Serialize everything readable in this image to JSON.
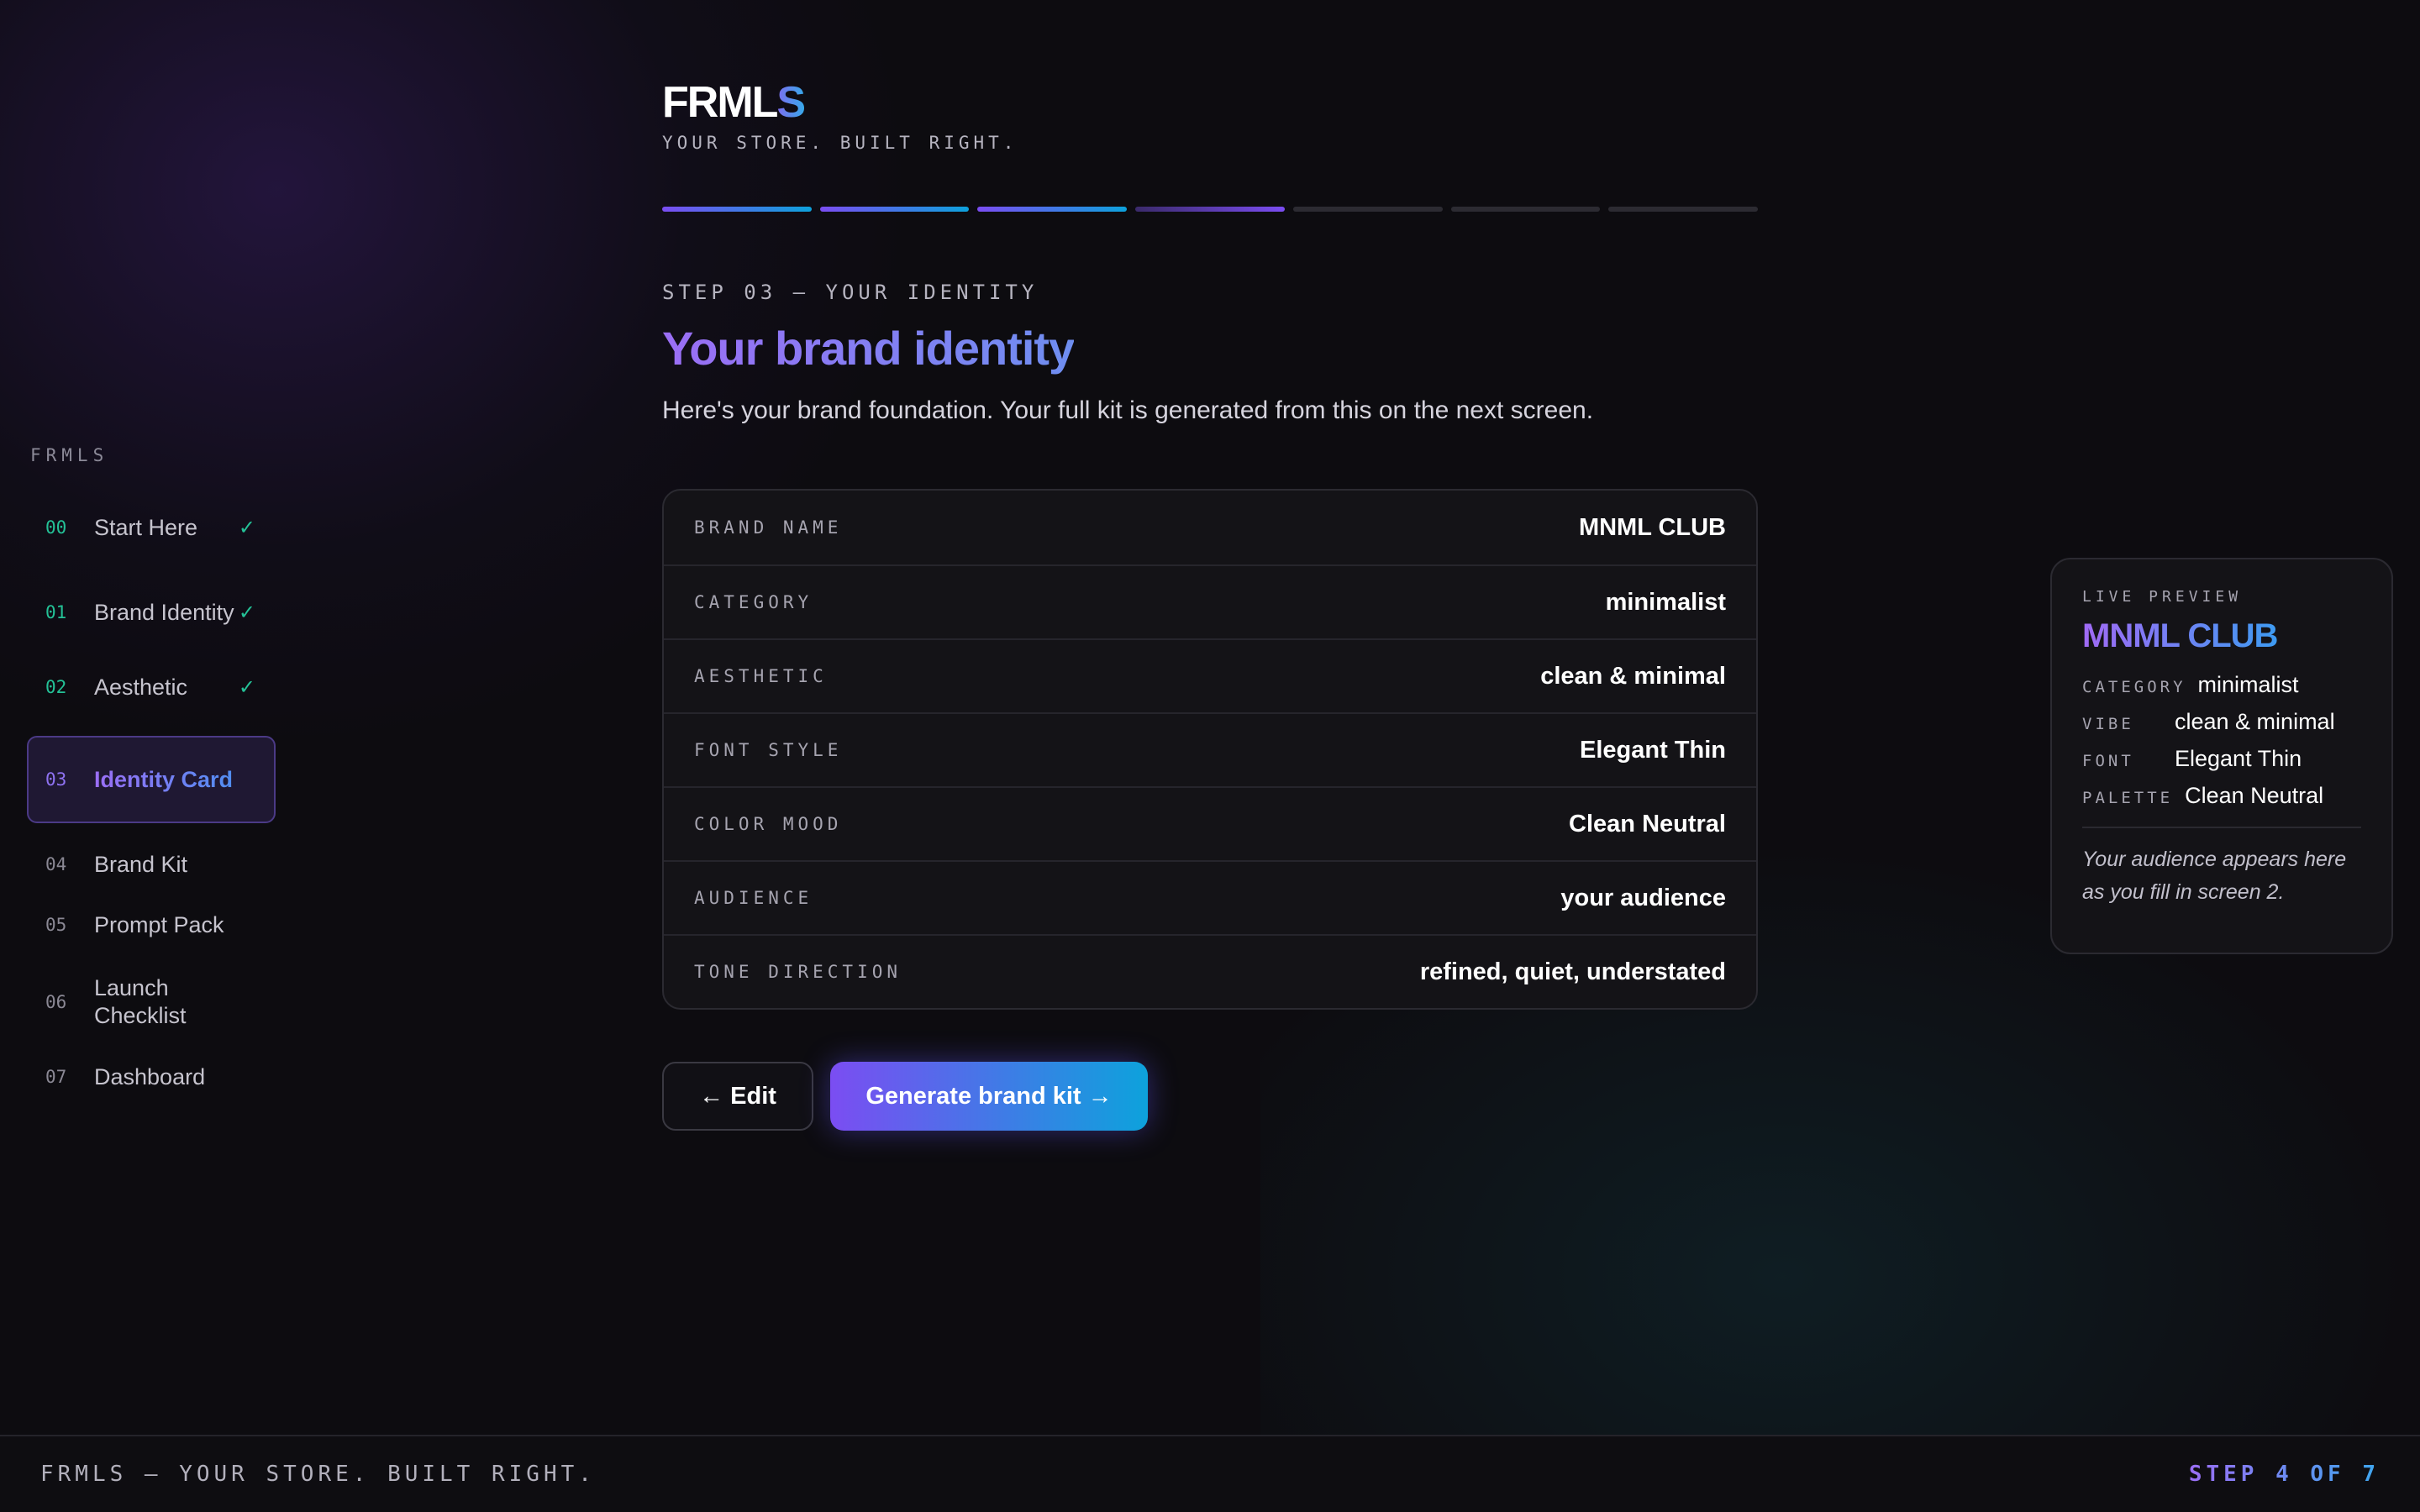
{
  "sidebar": {
    "brand": "FRMLS",
    "items": [
      {
        "num": "00",
        "label": "Start Here",
        "check": "✓"
      },
      {
        "num": "01",
        "label": "Brand Identity",
        "check": "✓"
      },
      {
        "num": "02",
        "label": "Aesthetic",
        "check": "✓"
      },
      {
        "num": "03",
        "label": "Identity Card"
      },
      {
        "num": "04",
        "label": "Brand Kit"
      },
      {
        "num": "05",
        "label": "Prompt Pack"
      },
      {
        "num": "06",
        "label": "Launch Checklist"
      },
      {
        "num": "07",
        "label": "Dashboard"
      }
    ]
  },
  "header": {
    "logo_main": "FRML",
    "logo_accent": "S",
    "tagline": "YOUR STORE. BUILT RIGHT."
  },
  "progress": {
    "total": 7,
    "completed": 3,
    "current": 4,
    "colors": {
      "completed": "linear-gradient(90deg,#7b4df2,#0da2dc)",
      "current": "linear-gradient(90deg,#3a2a6a,#7b4df2)",
      "pending": "#2c2b32"
    }
  },
  "main": {
    "step_label": "STEP 03 — YOUR IDENTITY",
    "title": "Your brand identity",
    "description": "Here's your brand foundation. Your full kit is generated from this on the next screen."
  },
  "identity": {
    "rows": [
      {
        "key": "BRAND NAME",
        "value": "MNML CLUB"
      },
      {
        "key": "CATEGORY",
        "value": "minimalist"
      },
      {
        "key": "AESTHETIC",
        "value": "clean & minimal"
      },
      {
        "key": "FONT STYLE",
        "value": "Elegant Thin"
      },
      {
        "key": "COLOR MOOD",
        "value": "Clean Neutral"
      },
      {
        "key": "AUDIENCE",
        "value": "your audience"
      },
      {
        "key": "TONE DIRECTION",
        "value": "refined, quiet, understated"
      }
    ]
  },
  "actions": {
    "edit": "← Edit",
    "generate": "Generate brand kit →"
  },
  "preview": {
    "label": "LIVE PREVIEW",
    "name": "MNML CLUB",
    "category_key": "CATEGORY",
    "category_val": "minimalist",
    "vibe_key": "VIBE",
    "vibe_val": "clean & minimal",
    "font_key": "FONT",
    "font_val": "Elegant Thin",
    "palette_key": "PALETTE",
    "palette_val": "Clean Neutral",
    "note": "Your audience appears here as you fill in screen 2."
  },
  "footer": {
    "left": "FRMLS — YOUR STORE. BUILT RIGHT.",
    "right": "STEP 4 OF 7"
  }
}
